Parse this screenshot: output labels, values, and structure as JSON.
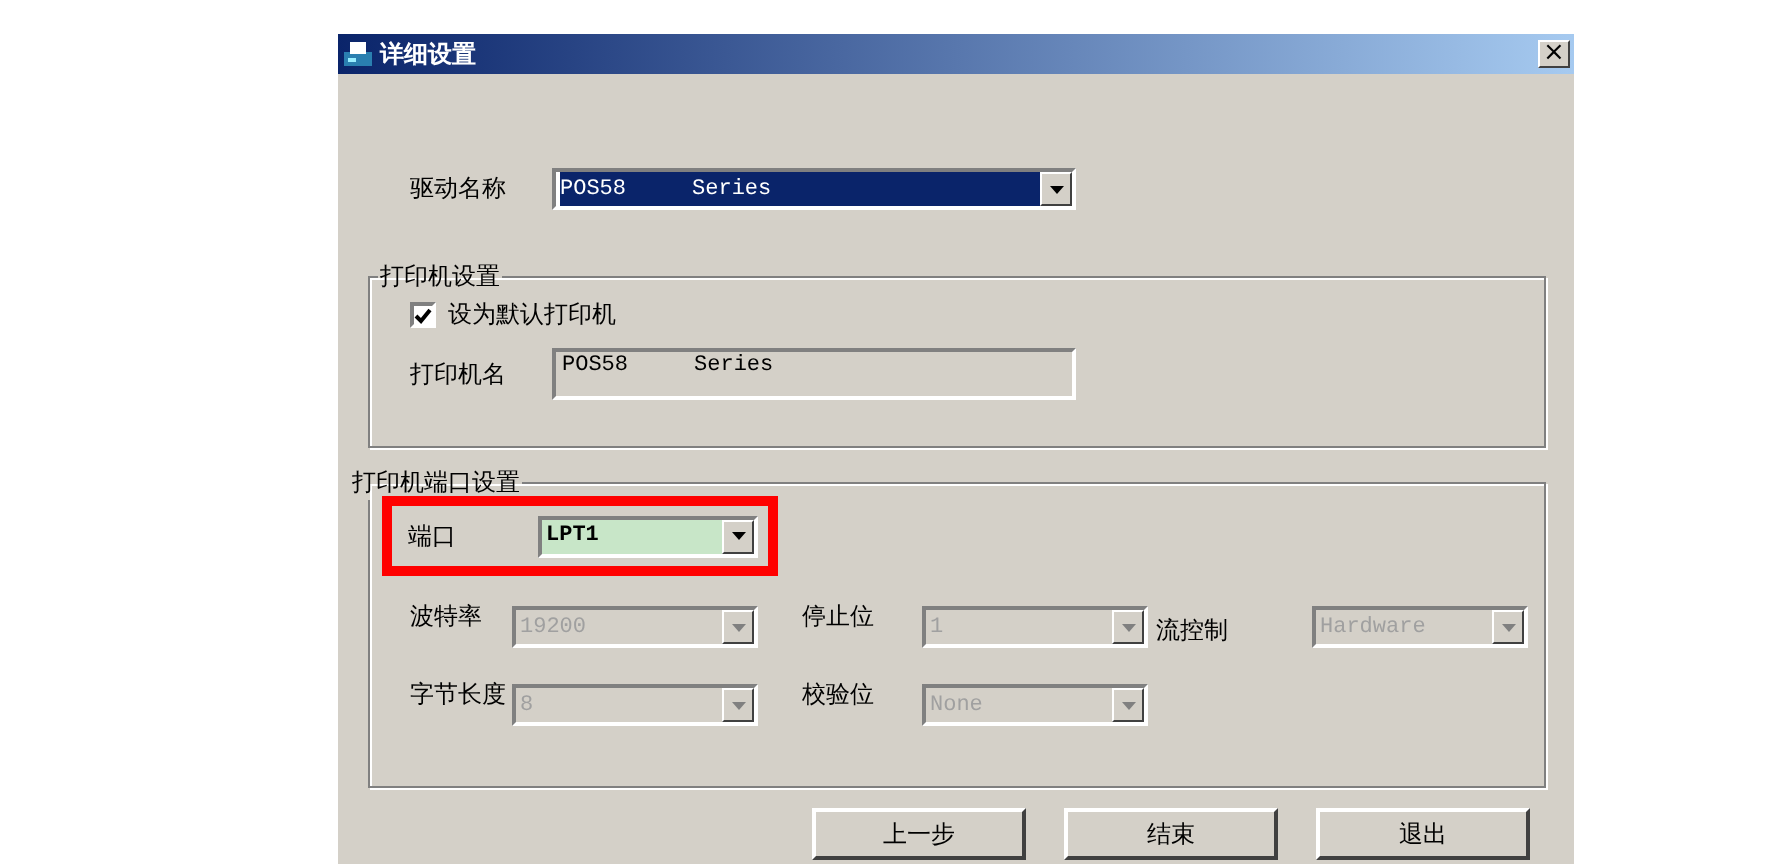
{
  "window": {
    "title": "详细设置",
    "close": "×"
  },
  "driver": {
    "label": "驱动名称",
    "value": "POS58     Series",
    "selected": true
  },
  "printer_group": {
    "title": "打印机设置",
    "default_printer": {
      "label": "设为默认打印机",
      "checked": true
    },
    "name_field": {
      "label": "打印机名",
      "value": "POS58     Series"
    }
  },
  "port_group": {
    "title": "打印机端口设置",
    "port": {
      "label": "端口",
      "value": "LPT1",
      "highlighted": true,
      "disabled": false
    },
    "settings": [
      [
        {
          "label": "波特率",
          "value": "19200",
          "disabled": true
        },
        {
          "label": "停止位",
          "value": "1",
          "disabled": true
        },
        {
          "label": "流控制",
          "value": "Hardware",
          "disabled": true
        }
      ],
      [
        {
          "label": "字节长度",
          "value": "8",
          "disabled": true
        },
        {
          "label": "校验位",
          "value": "None",
          "disabled": true
        }
      ]
    ]
  },
  "buttons": [
    "上一步",
    "结束",
    "退出"
  ]
}
